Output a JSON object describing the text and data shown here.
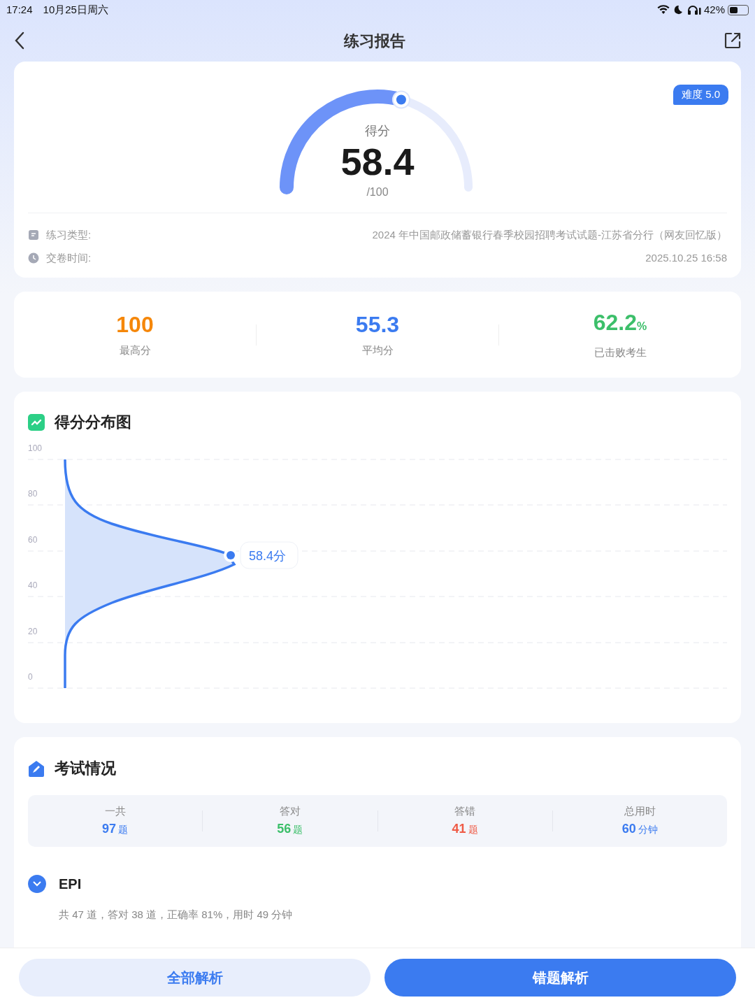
{
  "status_bar": {
    "time": "17:24",
    "date": "10月25日周六",
    "battery": "42%"
  },
  "nav": {
    "title": "练习报告"
  },
  "score": {
    "label": "得分",
    "value": "58.4",
    "total": "/100",
    "level": 0.584,
    "badge": "难度 5.0"
  },
  "info": [
    {
      "kind": "doc",
      "label": "练习类型:",
      "value": "2024 年中国邮政储蓄银行春季校园招聘考试试题-江苏省分行（网友回忆版）"
    },
    {
      "kind": "clock",
      "label": "交卷时间:",
      "value": "2025.10.25 16:58"
    }
  ],
  "stats": [
    {
      "value": "100",
      "label": "最高分",
      "color": "#f5870a"
    },
    {
      "value": "55.3",
      "label": "平均分",
      "color": "#3b7bf0"
    },
    {
      "value": "62.2",
      "unit": "%",
      "label": "已击败考生",
      "color": "#3cbf6a"
    }
  ],
  "distribution": {
    "title": "得分分布图",
    "y_labels": [
      "100",
      "80",
      "60",
      "40",
      "20",
      "0"
    ],
    "marker": "58.4分"
  },
  "exam": {
    "title": "考试情况",
    "summary": [
      {
        "label": "一共",
        "value": "97",
        "unit": "题",
        "color": "#3b7bf0"
      },
      {
        "label": "答对",
        "value": "56",
        "unit": "题",
        "color": "#3cbf6a"
      },
      {
        "label": "答错",
        "value": "41",
        "unit": "题",
        "color": "#ef5a45"
      },
      {
        "label": "总用时",
        "value": "60",
        "unit": "分钟",
        "color": "#3b7bf0"
      }
    ],
    "sections": [
      {
        "name": "EPI",
        "detail": "共 47 道，答对 38 道，正确率 81%，用时 49 分钟",
        "expanded": true
      }
    ]
  },
  "buttons": [
    {
      "label": "全部解析",
      "kind": "secondary"
    },
    {
      "label": "错题解析",
      "kind": "primary"
    }
  ]
}
